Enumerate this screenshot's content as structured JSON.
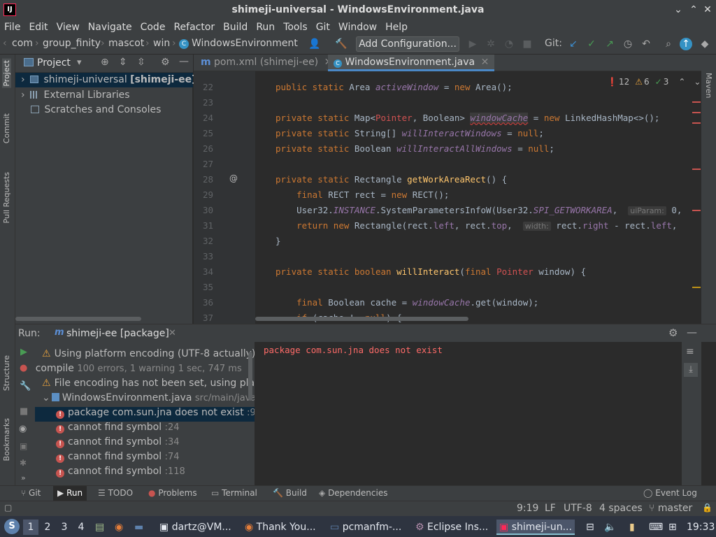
{
  "window": {
    "title": "shimeji-universal - WindowsEnvironment.java",
    "logo": "IJ",
    "minimize": "⌄",
    "maximize": "⌃",
    "close": "✕"
  },
  "menu": [
    "File",
    "Edit",
    "View",
    "Navigate",
    "Code",
    "Refactor",
    "Build",
    "Run",
    "Tools",
    "Git",
    "Window",
    "Help"
  ],
  "breadcrumb": [
    "com",
    "group_finity",
    "mascot",
    "win",
    "WindowsEnvironment"
  ],
  "toolbar": {
    "add_configuration": "Add Configuration...",
    "git_label": "Git:"
  },
  "left_stripe": [
    "Project",
    "Commit",
    "Pull Requests",
    "Structure",
    "Bookmarks"
  ],
  "right_stripe": [
    "Maven"
  ],
  "project": {
    "header": "Project",
    "items": [
      {
        "label": "shimeji-universal",
        "bold": "[shimeji-ee]"
      },
      {
        "label": "External Libraries"
      },
      {
        "label": "Scratches and Consoles"
      }
    ]
  },
  "editor": {
    "tabs": [
      "pom.xml (shimeji-ee)",
      "WindowsEnvironment.java"
    ],
    "inspections": {
      "errors": "12",
      "warnings": "6",
      "ok": "3"
    },
    "line_numbers": [
      "22",
      "23",
      "24",
      "25",
      "26",
      "27",
      "28",
      "29",
      "30",
      "31",
      "32",
      "33",
      "34",
      "35",
      "36",
      "37"
    ],
    "hints": {
      "uiParam": "uiParam:",
      "width": "width:"
    }
  },
  "run": {
    "label": "Run:",
    "config": "shimeji-ee [package]",
    "tree": [
      {
        "text": "Using platform encoding (UTF-8 actually)",
        "kind": "warn",
        "indent": 0
      },
      {
        "text": "compile",
        "detail": "100 errors, 1 warning",
        "time": "1 sec, 747 ms",
        "kind": "err",
        "indent": 0
      },
      {
        "text": "File encoding has not been set, using plat",
        "kind": "warn",
        "indent": 0
      },
      {
        "text": "WindowsEnvironment.java",
        "path": "src/main/java/",
        "kind": "file",
        "indent": 0
      },
      {
        "text": "package com.sun.jna does not exist",
        "line": ":9",
        "kind": "err",
        "indent": 1,
        "selected": true
      },
      {
        "text": "cannot find symbol",
        "line": ":24",
        "kind": "err",
        "indent": 1
      },
      {
        "text": "cannot find symbol",
        "line": ":34",
        "kind": "err",
        "indent": 1
      },
      {
        "text": "cannot find symbol",
        "line": ":74",
        "kind": "err",
        "indent": 1
      },
      {
        "text": "cannot find symbol",
        "line": ":118",
        "kind": "err",
        "indent": 1
      }
    ],
    "output": "package com.sun.jna does not exist"
  },
  "bottom_tabs": [
    "Git",
    "Run",
    "TODO",
    "Problems",
    "Terminal",
    "Build",
    "Dependencies"
  ],
  "status": {
    "event_log": "Event Log",
    "position": "9:19",
    "line_sep": "LF",
    "encoding": "UTF-8",
    "indent": "4 spaces",
    "branch": "master"
  },
  "taskbar": {
    "workspaces": [
      "1",
      "2",
      "3",
      "4"
    ],
    "tasks": [
      "dartz@VM...",
      "Thank You...",
      "pcmanfm-...",
      "Eclipse Ins...",
      "shimeji-un..."
    ],
    "clock": "19:33"
  },
  "colors": {
    "accent": "#4a88c7",
    "error": "#c75450",
    "warning": "#e8a33e",
    "selection": "#0d293e"
  }
}
